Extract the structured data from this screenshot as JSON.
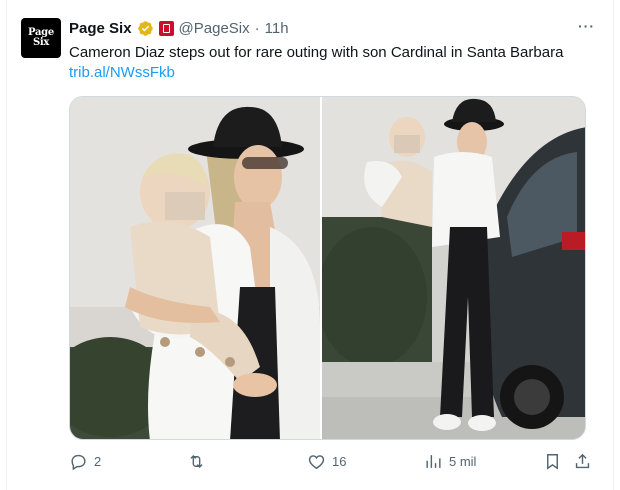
{
  "tweet": {
    "author_name": "Page Six",
    "avatar_line1": "Page",
    "avatar_line2": "Six",
    "handle": "@PageSix",
    "separator": "·",
    "time": "11h",
    "text": "Cameron Diaz steps out for rare outing with son Cardinal in Santa Barbara",
    "link": "trib.al/NWssFkb",
    "more_label": "···"
  },
  "metrics": {
    "replies": "2",
    "reposts": "",
    "likes": "16",
    "views": "5 mil"
  },
  "colors": {
    "link": "#1d9bf0",
    "verified_gold": "#e2b719",
    "affiliate_red": "#c8102e",
    "muted": "#536471"
  },
  "icons": [
    "verified-badge-icon",
    "affiliate-badge-icon",
    "more-icon",
    "reply-icon",
    "repost-icon",
    "like-icon",
    "views-icon",
    "bookmark-icon",
    "share-icon"
  ]
}
